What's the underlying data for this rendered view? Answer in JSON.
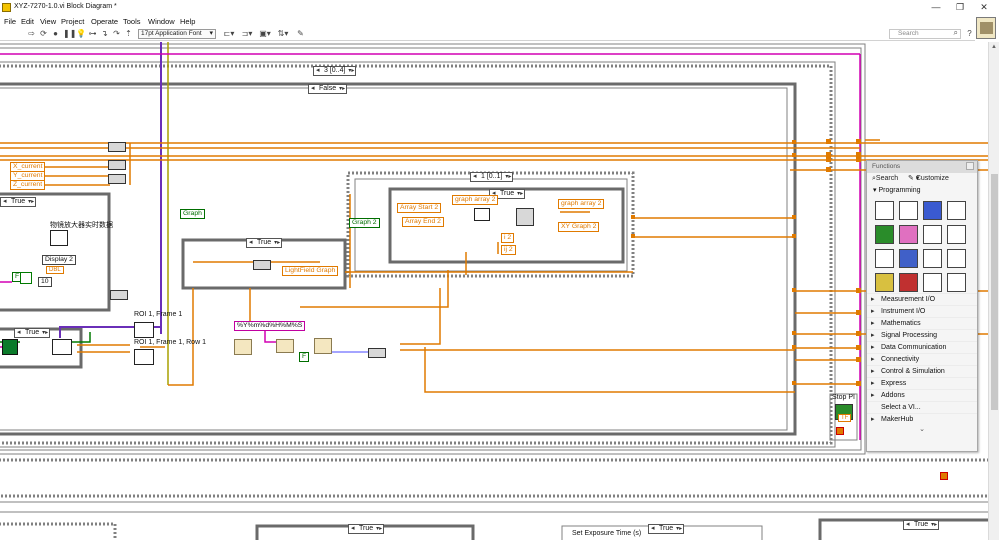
{
  "window": {
    "title": "XYZ-7270-1.0.vi Block Diagram *",
    "controls": [
      "—",
      "❐",
      "✕"
    ]
  },
  "menu": [
    "File",
    "Edit",
    "View",
    "Project",
    "Operate",
    "Tools",
    "Window",
    "Help"
  ],
  "toolbar": {
    "font": "17pt Application Font",
    "search_placeholder": "Search",
    "help": "?"
  },
  "diagram": {
    "sequence_label": "3 [0..4]",
    "case_false": "False",
    "case_true_left": "True",
    "case_true_small": "True",
    "case_true_mid": "True",
    "case_true_inner": "True",
    "seq_inner": "1 [0..1]",
    "bottom_true_1": "True",
    "bottom_true_2": "True",
    "bottom_true_3": "True",
    "x_current": "X_current",
    "y_current": "Y_current",
    "z_current": "Z_current",
    "chinese_label": "物镜放大器实时数据",
    "display2": "Display  2",
    "dbl": "DBL",
    "ten": "10",
    "graph": "Graph",
    "graph2": "Graph 2",
    "lightfield_graph": "LightField Graph",
    "array_start2": "Array Start 2",
    "array_end2": "Array End 2",
    "graph_array2_top": "graph array 2",
    "graph_array2_right": "graph array 2",
    "xy_graph2": "XY Graph 2",
    "ijk2": "i 2",
    "ij2": "ij 2",
    "roi_frame1": "ROI 1, Frame 1",
    "roi_frame_row": "ROI 1, Frame 1, Row 1",
    "time_format": "%Y%m%d%H%M%S",
    "stop_pi": "Stop PI",
    "set_exposure": "Set Exposure Time (s)",
    "tf": "TF",
    "f_const": "F"
  },
  "palette": {
    "title": "Functions",
    "search": "Search",
    "customize": "Customize",
    "programming": "Programming",
    "categories": [
      "Measurement I/O",
      "Instrument I/O",
      "Mathematics",
      "Signal Processing",
      "Data Communication",
      "Connectivity",
      "Control & Simulation",
      "Express",
      "Addons",
      "Select a VI...",
      "MakerHub"
    ],
    "more": "⌄"
  },
  "colors": {
    "wire_orange": "#e07a00",
    "wire_purple": "#6a2fb8",
    "wire_pink": "#d200b4",
    "wire_green": "#007a00",
    "wire_olive": "#a8a000",
    "frame_gray": "#808080"
  }
}
